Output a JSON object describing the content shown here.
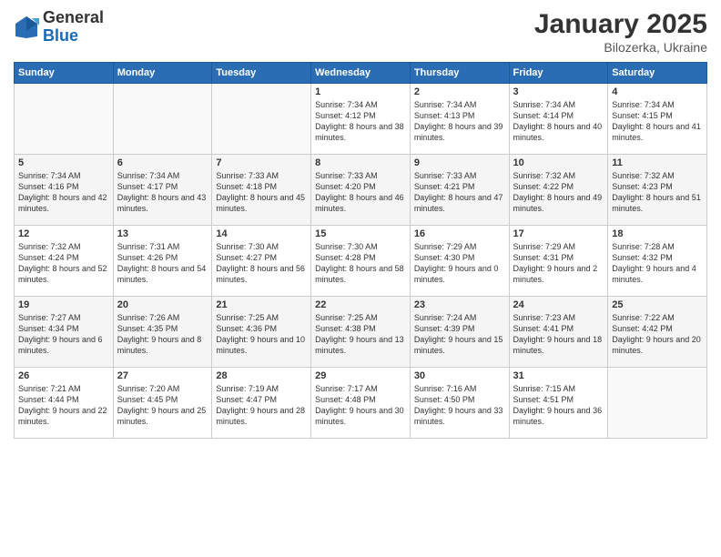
{
  "logo": {
    "general": "General",
    "blue": "Blue"
  },
  "header": {
    "month": "January 2025",
    "location": "Bilozerka, Ukraine"
  },
  "days_of_week": [
    "Sunday",
    "Monday",
    "Tuesday",
    "Wednesday",
    "Thursday",
    "Friday",
    "Saturday"
  ],
  "weeks": [
    [
      {
        "day": "",
        "info": ""
      },
      {
        "day": "",
        "info": ""
      },
      {
        "day": "",
        "info": ""
      },
      {
        "day": "1",
        "info": "Sunrise: 7:34 AM\nSunset: 4:12 PM\nDaylight: 8 hours and 38 minutes."
      },
      {
        "day": "2",
        "info": "Sunrise: 7:34 AM\nSunset: 4:13 PM\nDaylight: 8 hours and 39 minutes."
      },
      {
        "day": "3",
        "info": "Sunrise: 7:34 AM\nSunset: 4:14 PM\nDaylight: 8 hours and 40 minutes."
      },
      {
        "day": "4",
        "info": "Sunrise: 7:34 AM\nSunset: 4:15 PM\nDaylight: 8 hours and 41 minutes."
      }
    ],
    [
      {
        "day": "5",
        "info": "Sunrise: 7:34 AM\nSunset: 4:16 PM\nDaylight: 8 hours and 42 minutes."
      },
      {
        "day": "6",
        "info": "Sunrise: 7:34 AM\nSunset: 4:17 PM\nDaylight: 8 hours and 43 minutes."
      },
      {
        "day": "7",
        "info": "Sunrise: 7:33 AM\nSunset: 4:18 PM\nDaylight: 8 hours and 45 minutes."
      },
      {
        "day": "8",
        "info": "Sunrise: 7:33 AM\nSunset: 4:20 PM\nDaylight: 8 hours and 46 minutes."
      },
      {
        "day": "9",
        "info": "Sunrise: 7:33 AM\nSunset: 4:21 PM\nDaylight: 8 hours and 47 minutes."
      },
      {
        "day": "10",
        "info": "Sunrise: 7:32 AM\nSunset: 4:22 PM\nDaylight: 8 hours and 49 minutes."
      },
      {
        "day": "11",
        "info": "Sunrise: 7:32 AM\nSunset: 4:23 PM\nDaylight: 8 hours and 51 minutes."
      }
    ],
    [
      {
        "day": "12",
        "info": "Sunrise: 7:32 AM\nSunset: 4:24 PM\nDaylight: 8 hours and 52 minutes."
      },
      {
        "day": "13",
        "info": "Sunrise: 7:31 AM\nSunset: 4:26 PM\nDaylight: 8 hours and 54 minutes."
      },
      {
        "day": "14",
        "info": "Sunrise: 7:30 AM\nSunset: 4:27 PM\nDaylight: 8 hours and 56 minutes."
      },
      {
        "day": "15",
        "info": "Sunrise: 7:30 AM\nSunset: 4:28 PM\nDaylight: 8 hours and 58 minutes."
      },
      {
        "day": "16",
        "info": "Sunrise: 7:29 AM\nSunset: 4:30 PM\nDaylight: 9 hours and 0 minutes."
      },
      {
        "day": "17",
        "info": "Sunrise: 7:29 AM\nSunset: 4:31 PM\nDaylight: 9 hours and 2 minutes."
      },
      {
        "day": "18",
        "info": "Sunrise: 7:28 AM\nSunset: 4:32 PM\nDaylight: 9 hours and 4 minutes."
      }
    ],
    [
      {
        "day": "19",
        "info": "Sunrise: 7:27 AM\nSunset: 4:34 PM\nDaylight: 9 hours and 6 minutes."
      },
      {
        "day": "20",
        "info": "Sunrise: 7:26 AM\nSunset: 4:35 PM\nDaylight: 9 hours and 8 minutes."
      },
      {
        "day": "21",
        "info": "Sunrise: 7:25 AM\nSunset: 4:36 PM\nDaylight: 9 hours and 10 minutes."
      },
      {
        "day": "22",
        "info": "Sunrise: 7:25 AM\nSunset: 4:38 PM\nDaylight: 9 hours and 13 minutes."
      },
      {
        "day": "23",
        "info": "Sunrise: 7:24 AM\nSunset: 4:39 PM\nDaylight: 9 hours and 15 minutes."
      },
      {
        "day": "24",
        "info": "Sunrise: 7:23 AM\nSunset: 4:41 PM\nDaylight: 9 hours and 18 minutes."
      },
      {
        "day": "25",
        "info": "Sunrise: 7:22 AM\nSunset: 4:42 PM\nDaylight: 9 hours and 20 minutes."
      }
    ],
    [
      {
        "day": "26",
        "info": "Sunrise: 7:21 AM\nSunset: 4:44 PM\nDaylight: 9 hours and 22 minutes."
      },
      {
        "day": "27",
        "info": "Sunrise: 7:20 AM\nSunset: 4:45 PM\nDaylight: 9 hours and 25 minutes."
      },
      {
        "day": "28",
        "info": "Sunrise: 7:19 AM\nSunset: 4:47 PM\nDaylight: 9 hours and 28 minutes."
      },
      {
        "day": "29",
        "info": "Sunrise: 7:17 AM\nSunset: 4:48 PM\nDaylight: 9 hours and 30 minutes."
      },
      {
        "day": "30",
        "info": "Sunrise: 7:16 AM\nSunset: 4:50 PM\nDaylight: 9 hours and 33 minutes."
      },
      {
        "day": "31",
        "info": "Sunrise: 7:15 AM\nSunset: 4:51 PM\nDaylight: 9 hours and 36 minutes."
      },
      {
        "day": "",
        "info": ""
      }
    ]
  ]
}
